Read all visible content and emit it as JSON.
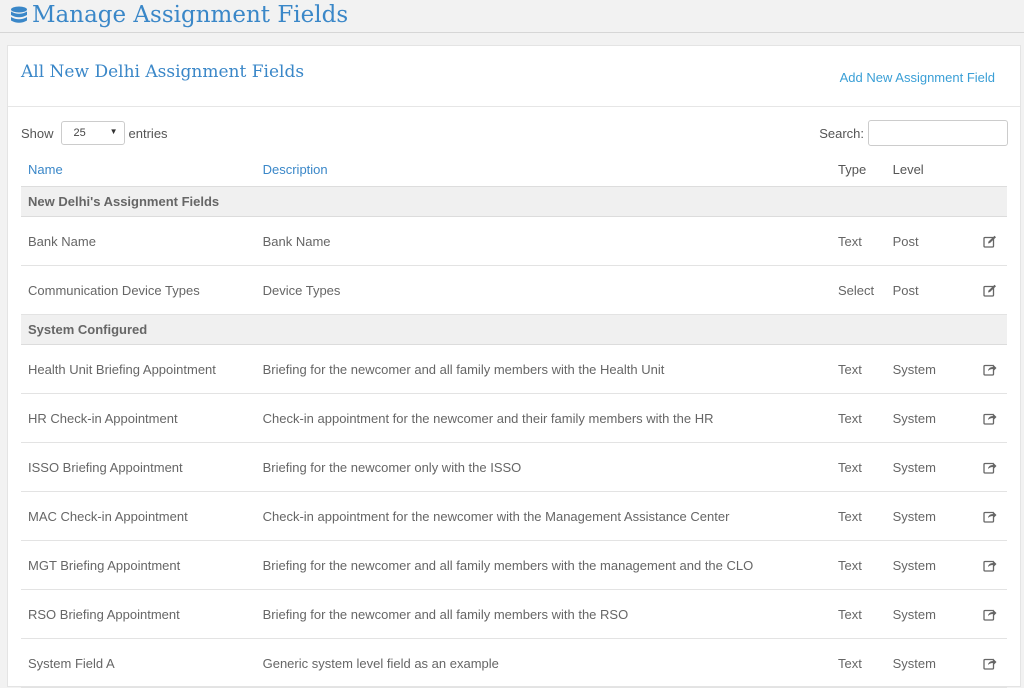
{
  "page": {
    "title": "Manage Assignment Fields"
  },
  "card": {
    "title": "All New Delhi Assignment Fields",
    "add_link": "Add New Assignment Field"
  },
  "controls": {
    "show_label": "Show",
    "show_value": "25",
    "entries_label": "entries",
    "search_label": "Search:",
    "search_value": ""
  },
  "columns": {
    "name": "Name",
    "description": "Description",
    "type": "Type",
    "level": "Level"
  },
  "groups": [
    {
      "label": "New Delhi's Assignment Fields",
      "action_icon": "edit-icon",
      "rows": [
        {
          "name": "Bank Name",
          "description": "Bank Name",
          "type": "Text",
          "level": "Post"
        },
        {
          "name": "Communication Device Types",
          "description": "Device Types",
          "type": "Select",
          "level": "Post"
        }
      ]
    },
    {
      "label": "System Configured",
      "action_icon": "share-icon",
      "rows": [
        {
          "name": "Health Unit Briefing Appointment",
          "description": "Briefing for the newcomer and all family members with the Health Unit",
          "type": "Text",
          "level": "System"
        },
        {
          "name": "HR Check-in Appointment",
          "description": "Check-in appointment for the newcomer and their family members with the HR",
          "type": "Text",
          "level": "System"
        },
        {
          "name": "ISSO Briefing Appointment",
          "description": "Briefing for the newcomer only with the ISSO",
          "type": "Text",
          "level": "System"
        },
        {
          "name": "MAC Check-in Appointment",
          "description": "Check-in appointment for the newcomer with the Management Assistance Center",
          "type": "Text",
          "level": "System"
        },
        {
          "name": "MGT Briefing Appointment",
          "description": "Briefing for the newcomer and all family members with the management and the CLO",
          "type": "Text",
          "level": "System"
        },
        {
          "name": "RSO Briefing Appointment",
          "description": "Briefing for the newcomer and all family members with the RSO",
          "type": "Text",
          "level": "System"
        },
        {
          "name": "System Field A",
          "description": "Generic system level field as an example",
          "type": "Text",
          "level": "System"
        }
      ]
    }
  ],
  "colors": {
    "accent": "#3a87c8",
    "link": "#3a9fd6",
    "group_bg": "#f0f0f0"
  }
}
